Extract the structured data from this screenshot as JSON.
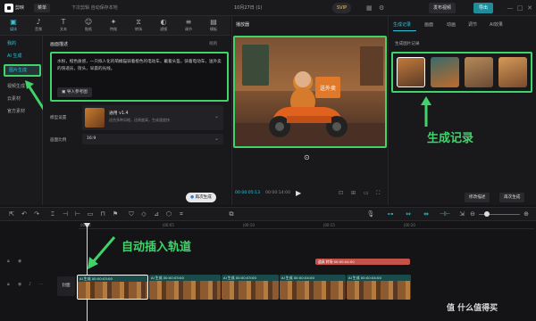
{
  "titlebar": {
    "app_name": "剪映",
    "menu_label": "菜单",
    "project_name": "下次剪辑   自动保存本地",
    "center_title": "10月27日 (1)",
    "svip_label": "SVIP",
    "share_label": "发布视频",
    "export_label": "导出"
  },
  "toolbar": {
    "tools": [
      {
        "label": "媒体",
        "icon": "▣"
      },
      {
        "label": "音频",
        "icon": "♪"
      },
      {
        "label": "文本",
        "icon": "T"
      },
      {
        "label": "贴纸",
        "icon": "☺"
      },
      {
        "label": "特效",
        "icon": "✦"
      },
      {
        "label": "转场",
        "icon": "⧖"
      },
      {
        "label": "滤镜",
        "icon": "◐"
      },
      {
        "label": "调节",
        "icon": "≡"
      },
      {
        "label": "模板",
        "icon": "▤"
      }
    ]
  },
  "sidebar": {
    "items": [
      {
        "label": "我的"
      },
      {
        "label": "AI 生成"
      },
      {
        "label": "图片生成"
      },
      {
        "label": "视频生成"
      },
      {
        "label": "云素材"
      },
      {
        "label": "官方素材"
      }
    ]
  },
  "left_panel": {
    "section_title": "画面描述",
    "rules_label": "规则",
    "prompt": "水粉，橙色质感，一只拟人化的萌橘猫骑着橙色的电动车，戴着头盔，骑着电动车，送外卖的快递员，街头，早晨的光线。",
    "ref_button": "导入参考图",
    "model_label": "模型设置",
    "model_name": "通用 v1.4",
    "model_desc": "适合多种风格，还原度高，生成速度快",
    "ratio_label": "画面比例",
    "ratio_value": "16:9",
    "generate_button": "再次生成"
  },
  "player": {
    "title": "播放器",
    "current_time": "00:00:05:13",
    "total_time": "00:00:14:00",
    "box_text": "送外卖"
  },
  "right_panel": {
    "tabs": [
      {
        "label": "生成记录",
        "active": true
      },
      {
        "label": "画面"
      },
      {
        "label": "动画"
      },
      {
        "label": "调节"
      },
      {
        "label": "AI效果"
      }
    ],
    "section_label": "生成图片记录",
    "edit_button": "修改描述",
    "regen_button": "再次生成"
  },
  "timeline": {
    "ruler": [
      "00:00",
      "|00:05",
      "|00:10",
      "|00:15",
      "|00:20"
    ],
    "red_clip_label": "道具 转场 00:00:04:00",
    "cover_label": "封面",
    "clips": [
      {
        "label": "AI 生成   00:00:03:00"
      },
      {
        "label": "AI 生成   00:00:03:00"
      },
      {
        "label": "AI 生成   00:00:03:00"
      },
      {
        "label": "AI 生成   00:00:04:00"
      },
      {
        "label": "AI 生成   00:00:04:00"
      }
    ]
  },
  "annotations": {
    "gen_record": "生成记录",
    "auto_insert": "自动插入轨道"
  },
  "watermark": "值 什么值得买"
}
